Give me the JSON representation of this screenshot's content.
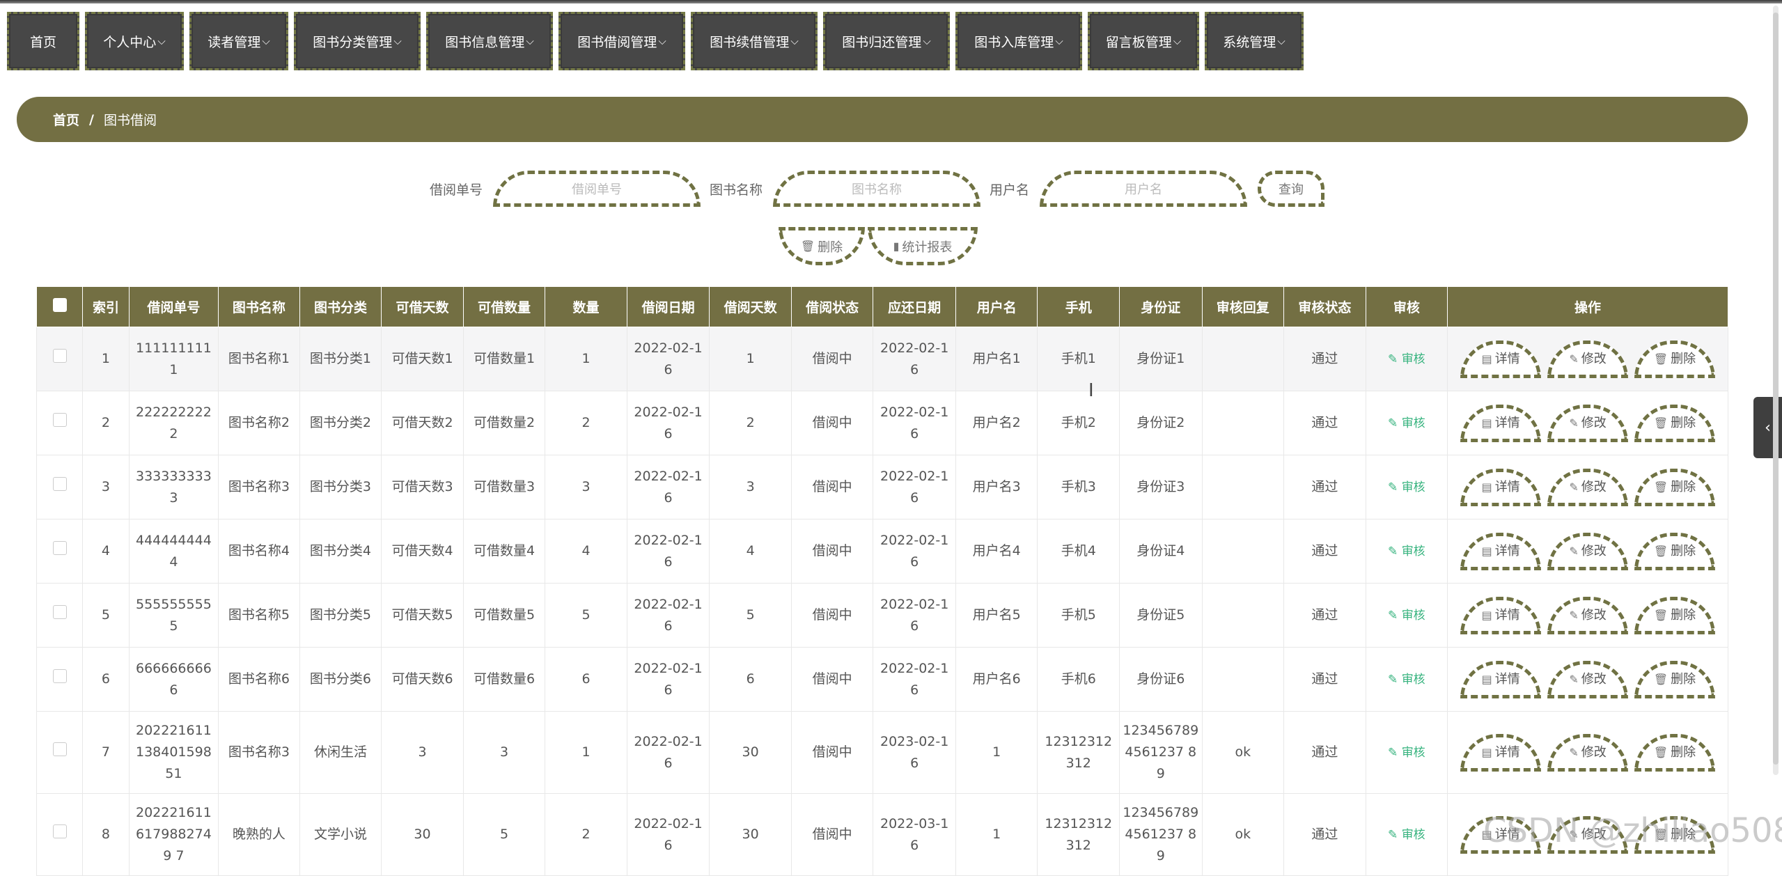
{
  "nav": [
    "首页",
    "个人中心",
    "读者管理",
    "图书分类管理",
    "图书信息管理",
    "图书借阅管理",
    "图书续借管理",
    "图书归还管理",
    "图书入库管理",
    "留言板管理",
    "系统管理"
  ],
  "breadcrumb": {
    "home": "首页",
    "sep": "/",
    "current": "图书借阅"
  },
  "search": {
    "borrow_no_label": "借阅单号",
    "borrow_no_placeholder": "借阅单号",
    "book_name_label": "图书名称",
    "book_name_placeholder": "图书名称",
    "username_label": "用户名",
    "username_placeholder": "用户名",
    "query": "查询",
    "delete": "删除",
    "report": "统计报表"
  },
  "table": {
    "headers": [
      "索引",
      "借阅单号",
      "图书名称",
      "图书分类",
      "可借天数",
      "可借数量",
      "数量",
      "借阅日期",
      "借阅天数",
      "借阅状态",
      "应还日期",
      "用户名",
      "手机",
      "身份证",
      "审核回复",
      "审核状态",
      "审核",
      "操作"
    ],
    "audit_label": "审核",
    "op_labels": {
      "detail": "详情",
      "edit": "修改",
      "delete": "删除"
    },
    "rows": [
      {
        "index": "1",
        "no": "1111111111",
        "name": "图书名称1",
        "cat": "图书分类1",
        "days": "可借天数1",
        "qty": "可借数量1",
        "num": "1",
        "date": "2022-02-16",
        "bdays": "1",
        "status": "借阅中",
        "due": "2022-02-16",
        "user": "用户名1",
        "phone": "手机1",
        "id": "身份证1",
        "reply": "",
        "astatus": "通过"
      },
      {
        "index": "2",
        "no": "2222222222",
        "name": "图书名称2",
        "cat": "图书分类2",
        "days": "可借天数2",
        "qty": "可借数量2",
        "num": "2",
        "date": "2022-02-16",
        "bdays": "2",
        "status": "借阅中",
        "due": "2022-02-16",
        "user": "用户名2",
        "phone": "手机2",
        "id": "身份证2",
        "reply": "",
        "astatus": "通过"
      },
      {
        "index": "3",
        "no": "3333333333",
        "name": "图书名称3",
        "cat": "图书分类3",
        "days": "可借天数3",
        "qty": "可借数量3",
        "num": "3",
        "date": "2022-02-16",
        "bdays": "3",
        "status": "借阅中",
        "due": "2022-02-16",
        "user": "用户名3",
        "phone": "手机3",
        "id": "身份证3",
        "reply": "",
        "astatus": "通过"
      },
      {
        "index": "4",
        "no": "4444444444",
        "name": "图书名称4",
        "cat": "图书分类4",
        "days": "可借天数4",
        "qty": "可借数量4",
        "num": "4",
        "date": "2022-02-16",
        "bdays": "4",
        "status": "借阅中",
        "due": "2022-02-16",
        "user": "用户名4",
        "phone": "手机4",
        "id": "身份证4",
        "reply": "",
        "astatus": "通过"
      },
      {
        "index": "5",
        "no": "5555555555",
        "name": "图书名称5",
        "cat": "图书分类5",
        "days": "可借天数5",
        "qty": "可借数量5",
        "num": "5",
        "date": "2022-02-16",
        "bdays": "5",
        "status": "借阅中",
        "due": "2022-02-16",
        "user": "用户名5",
        "phone": "手机5",
        "id": "身份证5",
        "reply": "",
        "astatus": "通过"
      },
      {
        "index": "6",
        "no": "6666666666",
        "name": "图书名称6",
        "cat": "图书分类6",
        "days": "可借天数6",
        "qty": "可借数量6",
        "num": "6",
        "date": "2022-02-16",
        "bdays": "6",
        "status": "借阅中",
        "due": "2022-02-16",
        "user": "用户名6",
        "phone": "手机6",
        "id": "身份证6",
        "reply": "",
        "astatus": "通过"
      },
      {
        "index": "7",
        "no": "20222161113840159851",
        "name": "图书名称3",
        "cat": "休闲生活",
        "days": "3",
        "qty": "3",
        "num": "1",
        "date": "2022-02-16",
        "bdays": "30",
        "status": "借阅中",
        "due": "2023-02-16",
        "user": "1",
        "phone": "12312312312",
        "id": "1234567894561237 89",
        "reply": "ok",
        "astatus": "通过"
      },
      {
        "index": "8",
        "no": "2022216116179882749 7",
        "name": "晚熟的人",
        "cat": "文学小说",
        "days": "30",
        "qty": "5",
        "num": "2",
        "date": "2022-02-16",
        "bdays": "30",
        "status": "借阅中",
        "due": "2022-03-16",
        "user": "1",
        "phone": "12312312312",
        "id": "1234567894561237 89",
        "reply": "ok",
        "astatus": "通过"
      }
    ]
  },
  "watermark": "CSDN @zhiliao508",
  "colors": {
    "primary": "#736f43",
    "dashed": "#707243",
    "nav_bg": "#474747",
    "audit_green": "#36b37e"
  }
}
